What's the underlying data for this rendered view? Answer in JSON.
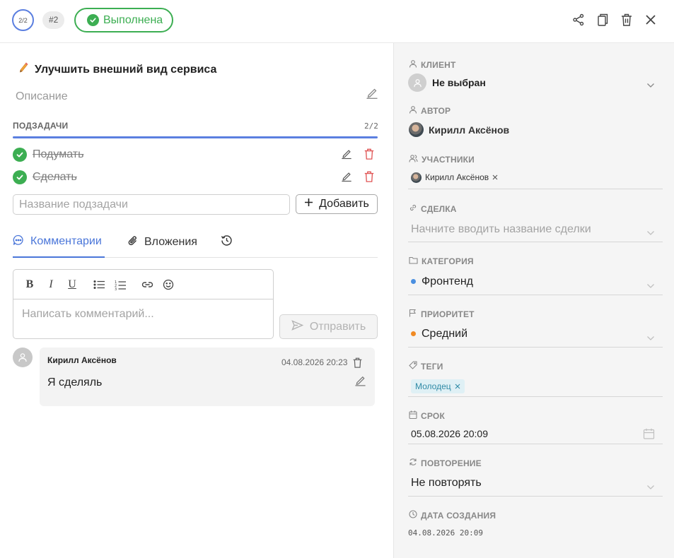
{
  "header": {
    "progress": "2/2",
    "task_number": "#2",
    "status": "Выполнена"
  },
  "task": {
    "title": "Улучшить внешний вид сервиса",
    "description_placeholder": "Описание"
  },
  "subtasks": {
    "heading": "ПОДЗАДАЧИ",
    "count": "2/2",
    "progress_fraction": 1.0,
    "items": [
      {
        "label": "Подумать",
        "done": true
      },
      {
        "label": "Сделать",
        "done": true
      }
    ],
    "input_placeholder": "Название подзадачи",
    "add_label": "Добавить"
  },
  "tabs": {
    "comments": "Комментарии",
    "attachments": "Вложения"
  },
  "editor": {
    "bold": "B",
    "italic": "I",
    "underline": "U",
    "placeholder": "Написать комментарий...",
    "send_label": "Отправить"
  },
  "comments": [
    {
      "author": "Кирилл Аксёнов",
      "date": "04.08.2026 20:23",
      "text": "Я сделяль"
    }
  ],
  "sidebar": {
    "client": {
      "label": "КЛИЕНТ",
      "value": "Не выбран"
    },
    "author": {
      "label": "АВТОР",
      "value": "Кирилл Аксёнов"
    },
    "participants": {
      "label": "УЧАСТНИКИ",
      "items": [
        "Кирилл Аксёнов"
      ]
    },
    "deal": {
      "label": "СДЕЛКА",
      "placeholder": "Начните вводить название сделки"
    },
    "category": {
      "label": "КАТЕГОРИЯ",
      "value": "Фронтенд",
      "color": "#4a8fe0"
    },
    "priority": {
      "label": "ПРИОРИТЕТ",
      "value": "Средний",
      "color": "#f08a24"
    },
    "tags": {
      "label": "ТЕГИ",
      "items": [
        "Молодец"
      ]
    },
    "deadline": {
      "label": "СРОК",
      "value": "05.08.2026 20:09"
    },
    "repeat": {
      "label": "ПОВТОРЕНИЕ",
      "value": "Не повторять"
    },
    "created": {
      "label": "ДАТА СОЗДАНИЯ",
      "value": "04.08.2026 20:09"
    }
  },
  "colors": {
    "accent": "#4a76d9",
    "success": "#3cae52",
    "danger": "#e05555",
    "tag_bg": "#dff0f5",
    "tag_text": "#2f8aa6"
  }
}
